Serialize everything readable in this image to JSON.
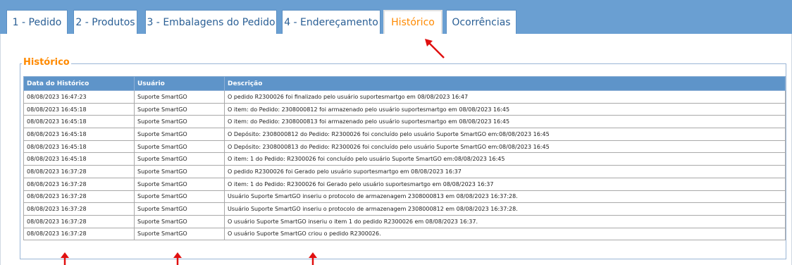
{
  "tabs": [
    {
      "label": "1 - Pedido"
    },
    {
      "label": "2 - Produtos"
    },
    {
      "label": "3 - Embalagens do Pedido"
    },
    {
      "label": "4 - Endereçamento"
    },
    {
      "label": "Histórico"
    },
    {
      "label": "Ocorrências"
    }
  ],
  "active_tab": "Histórico",
  "section": {
    "title": "Histórico"
  },
  "table": {
    "headers": [
      "Data do Histórico",
      "Usuário",
      "Descrição"
    ],
    "rows": [
      [
        "08/08/2023 16:47:23",
        "Suporte SmartGO",
        "O pedido R2300026 foi finalizado pelo usuário suportesmartgo em 08/08/2023 16:47"
      ],
      [
        "08/08/2023 16:45:18",
        "Suporte SmartGO",
        "O item: do Pedido: 2308000812 foi armazenado pelo usuário suportesmartgo em 08/08/2023 16:45"
      ],
      [
        "08/08/2023 16:45:18",
        "Suporte SmartGO",
        "O item: do Pedido: 2308000813 foi armazenado pelo usuário suportesmartgo em 08/08/2023 16:45"
      ],
      [
        "08/08/2023 16:45:18",
        "Suporte SmartGO",
        "O Depósito: 2308000812 do Pedido: R2300026 foi concluído pelo usuário Suporte SmartGO em:08/08/2023 16:45"
      ],
      [
        "08/08/2023 16:45:18",
        "Suporte SmartGO",
        "O Depósito: 2308000813 do Pedido: R2300026 foi concluído pelo usuário Suporte SmartGO em:08/08/2023 16:45"
      ],
      [
        "08/08/2023 16:45:18",
        "Suporte SmartGO",
        "O item: 1 do Pedido: R2300026 foi concluído pelo usuário Suporte SmartGO em:08/08/2023 16:45"
      ],
      [
        "08/08/2023 16:37:28",
        "Suporte SmartGO",
        "O pedido R2300026 foi Gerado pelo usuário suportesmartgo em 08/08/2023 16:37"
      ],
      [
        "08/08/2023 16:37:28",
        "Suporte SmartGO",
        "O item: 1 do Pedido: R2300026 foi Gerado pelo usuário suportesmartgo em 08/08/2023 16:37"
      ],
      [
        "08/08/2023 16:37:28",
        "Suporte SmartGO",
        "Usuário Suporte SmartGO inseriu o protocolo de armazenagem 2308000813 em 08/08/2023 16:37:28."
      ],
      [
        "08/08/2023 16:37:28",
        "Suporte SmartGO",
        "Usuário Suporte SmartGO inseriu o protocolo de armazenagem 2308000812 em 08/08/2023 16:37:28."
      ],
      [
        "08/08/2023 16:37:28",
        "Suporte SmartGO",
        "O usuário Suporte SmartGO inseriu o item 1 do pedido R2300026 em 08/08/2023 16:37."
      ],
      [
        "08/08/2023 16:37:28",
        "Suporte SmartGO",
        "O usuário Suporte SmartGO criou o pedido R2300026."
      ]
    ]
  },
  "colors": {
    "tabbar": "#6a9fd2",
    "header": "#5e94c9",
    "accent": "#ff8a00",
    "arrow": "#e01010"
  },
  "annotations": [
    {
      "icon": "red-arrow-icon",
      "points_to": "Histórico"
    },
    {
      "icon": "red-arrow-icon",
      "points_to": "Data do Histórico"
    },
    {
      "icon": "red-arrow-icon",
      "points_to": "Usuário"
    },
    {
      "icon": "red-arrow-icon",
      "points_to": "Descrição"
    }
  ]
}
